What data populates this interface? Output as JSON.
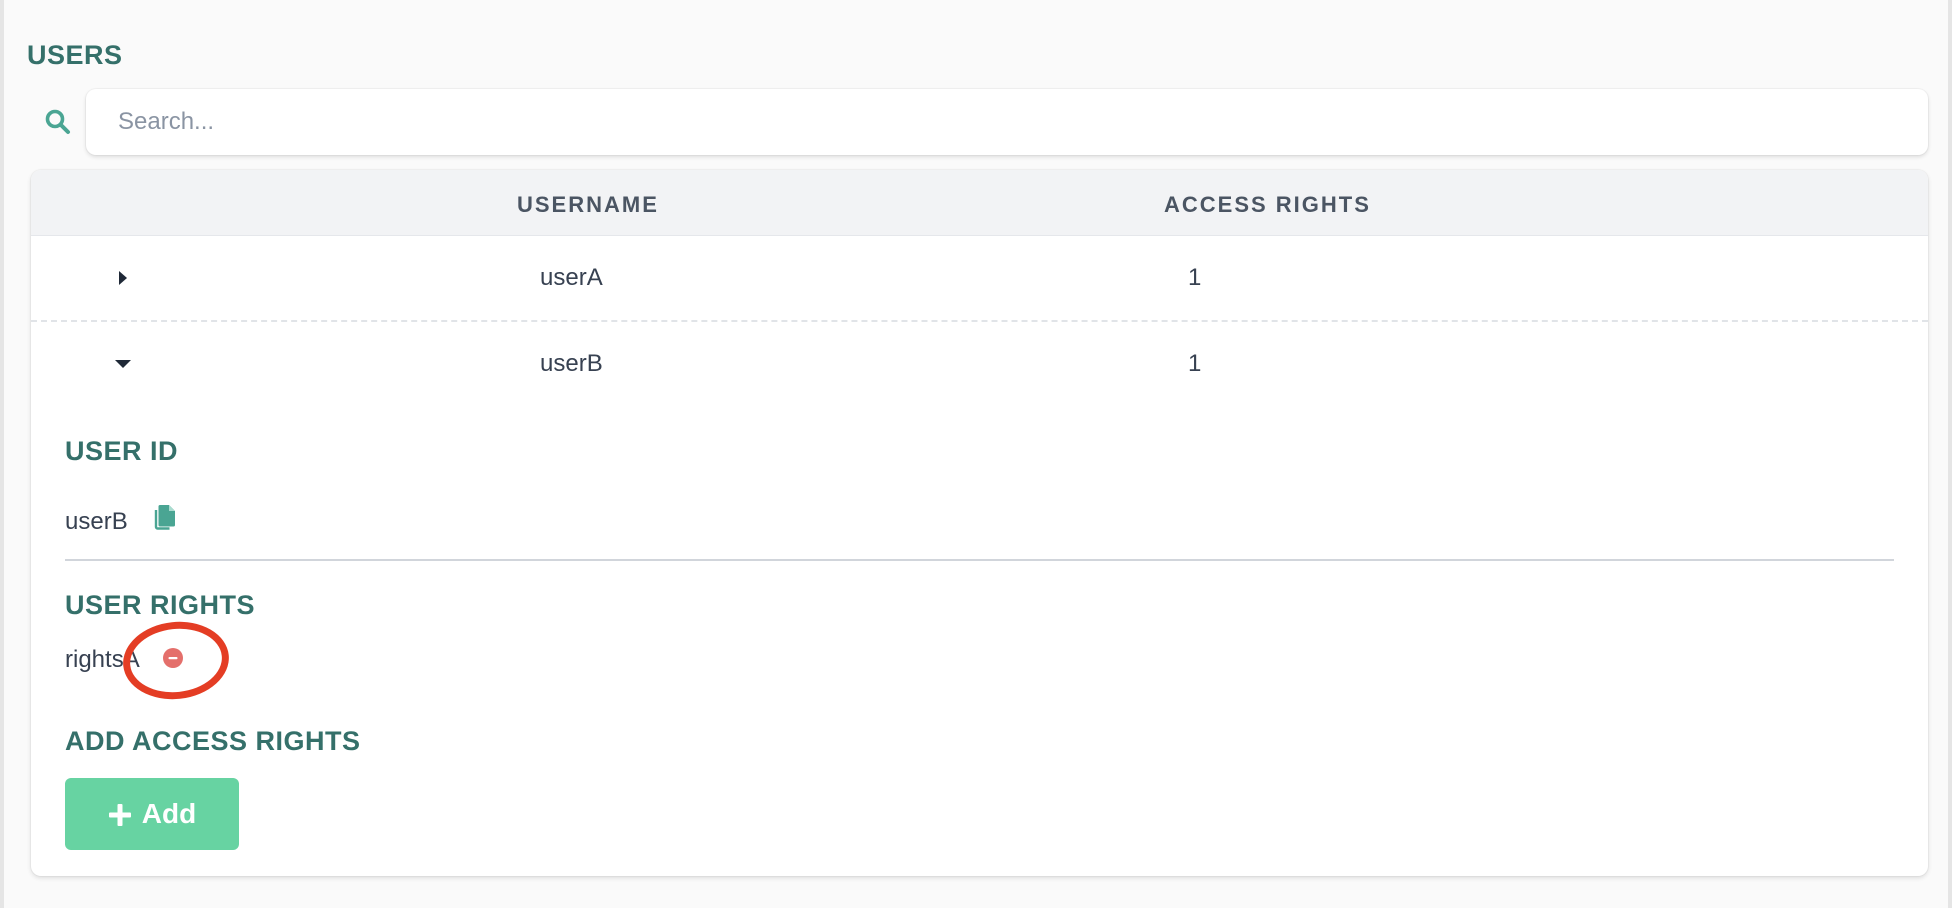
{
  "header": {
    "title": "USERS"
  },
  "search": {
    "placeholder": "Search...",
    "value": "",
    "icon": "search-icon"
  },
  "table": {
    "columns": [
      "USERNAME",
      "ACCESS RIGHTS"
    ],
    "rows": [
      {
        "username": "userA",
        "access_rights": "1",
        "expanded": false
      },
      {
        "username": "userB",
        "access_rights": "1",
        "expanded": true
      }
    ]
  },
  "detail": {
    "user_id_title": "USER ID",
    "user_id_value": "userB",
    "user_rights_title": "USER RIGHTS",
    "rights": [
      {
        "name": "rightsA",
        "remove_icon": "minus-circle-icon"
      }
    ],
    "add_rights_title": "ADD ACCESS RIGHTS",
    "add_button_label": "Add"
  },
  "colors": {
    "accent_text": "#35706a",
    "search_icon": "#4aa593",
    "add_button": "#67d3a2",
    "remove_icon": "#e46f6b",
    "highlight_ring": "#e43d24"
  }
}
